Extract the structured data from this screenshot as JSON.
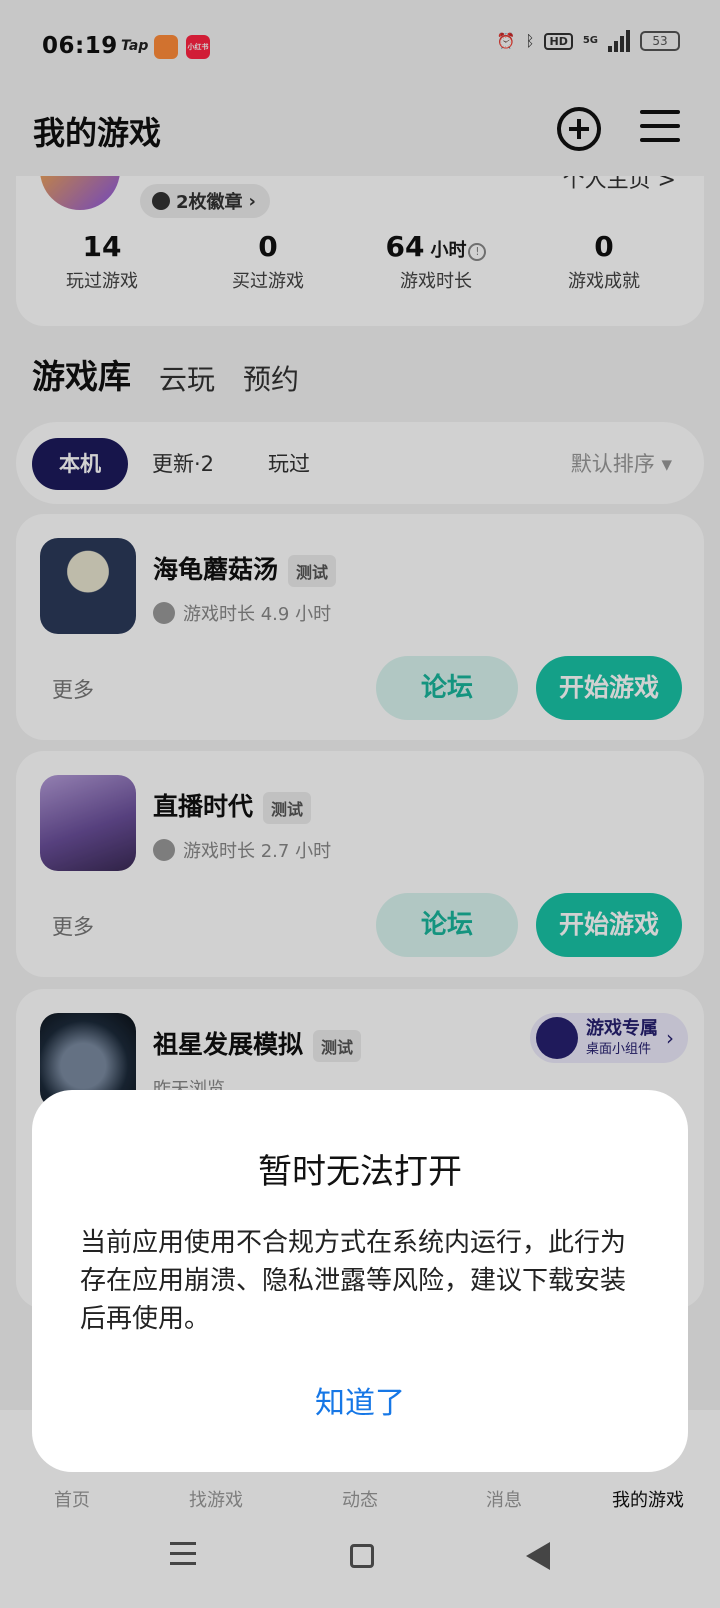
{
  "status_bar": {
    "time": "06:19",
    "app_tap": "Tap",
    "app_xhs": "小红书",
    "hd": "HD",
    "network": "5G",
    "battery": "53"
  },
  "header": {
    "title": "我的游戏"
  },
  "profile": {
    "badge_label": "2枚徽章",
    "homepage_label": "个人主页 >",
    "stats": [
      {
        "value": "14",
        "unit": "",
        "label": "玩过游戏"
      },
      {
        "value": "0",
        "unit": "",
        "label": "买过游戏"
      },
      {
        "value": "64",
        "unit": "小时",
        "label": "游戏时长"
      },
      {
        "value": "0",
        "unit": "",
        "label": "游戏成就"
      }
    ]
  },
  "main_tabs": [
    "游戏库",
    "云玩",
    "预约"
  ],
  "filters": {
    "chips": [
      "本机",
      "更新·2",
      "玩过"
    ],
    "sort_label": "默认排序 ▾"
  },
  "games": [
    {
      "name": "海龟蘑菇汤",
      "tag": "测试",
      "playtime": "游戏时长 4.9 小时",
      "more": "更多",
      "forum": "论坛",
      "play": "开始游戏"
    },
    {
      "name": "直播时代",
      "tag": "测试",
      "playtime": "游戏时长 2.7 小时",
      "more": "更多",
      "forum": "论坛",
      "play": "开始游戏"
    },
    {
      "name": "祖星发展模拟",
      "tag": "测试",
      "subtitle": "昨天浏览",
      "widget_title": "游戏专属",
      "widget_sub": "桌面小组件"
    }
  ],
  "bottom_nav": [
    "首页",
    "找游戏",
    "动态",
    "消息",
    "我的游戏"
  ],
  "dialog": {
    "title": "暂时无法打开",
    "body": "当前应用使用不合规方式在系统内运行，此行为存在应用崩溃、隐私泄露等风险，建议下载安装后再使用。",
    "button": "知道了"
  },
  "colors": {
    "accent": "#19c4a7",
    "navy": "#1d1a5c",
    "link_blue": "#1677e6"
  }
}
